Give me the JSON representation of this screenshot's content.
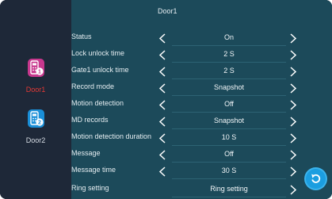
{
  "header": {
    "title": "Door1"
  },
  "doors": [
    {
      "label": "Door1",
      "badge": "1",
      "selected": true,
      "color": "#c8388e"
    },
    {
      "label": "Door2",
      "badge": "2",
      "selected": false,
      "color": "#1a8fd8"
    }
  ],
  "settings": [
    {
      "label": "Status",
      "value": "On"
    },
    {
      "label": "Lock unlock time",
      "value": "2 S"
    },
    {
      "label": "Gate1 unlock time",
      "value": "2 S"
    },
    {
      "label": "Record mode",
      "value": "Snapshot"
    },
    {
      "label": "Motion detection",
      "value": "Off"
    },
    {
      "label": "MD records",
      "value": "Snapshot"
    },
    {
      "label": "Motion detection duration",
      "value": "10 S"
    },
    {
      "label": "Message",
      "value": "Off"
    },
    {
      "label": "Message time",
      "value": "30 S"
    },
    {
      "label": "Ring setting",
      "value": "Ring setting"
    }
  ],
  "icons": {
    "prev": "chevron-left-icon",
    "next": "chevron-right-icon",
    "back": "back-icon",
    "door": "door-phone-icon"
  },
  "colors": {
    "background": "#111c27",
    "sidebar": "#1e2838",
    "content": "#1c4a5a",
    "selected_door": "#e53935",
    "accent": "#1b9ee0"
  }
}
